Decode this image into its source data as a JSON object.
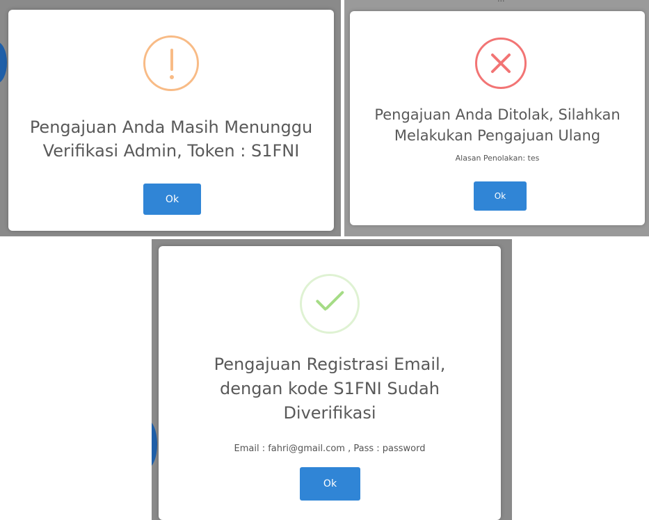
{
  "dialogs": {
    "warning": {
      "icon": "exclamation-icon",
      "icon_glyph": "!",
      "accent": "#f8bb86",
      "title_line1": "Pengajuan Anda Masih Menunggu",
      "title_line2": "Verifikasi Admin, Token : S1FNI",
      "ok_label": "Ok"
    },
    "error": {
      "icon": "x-mark-icon",
      "accent": "#f27474",
      "title_line1": "Pengajuan Anda Ditolak, Silahkan",
      "title_line2": "Melakukan Pengajuan Ulang",
      "reason": "Alasan Penolakan: tes",
      "ok_label": "Ok"
    },
    "success": {
      "icon": "checkmark-icon",
      "accent": "#a5dc86",
      "title_line1": "Pengajuan Registrasi Email,",
      "title_line2": "dengan kode S1FNI Sudah",
      "title_line3": "Diverifikasi",
      "detail": "Email : fahri@gmail.com , Pass : password",
      "ok_label": "Ok"
    }
  },
  "colors": {
    "button": "#3085d6",
    "backdrop": "#8a8a8a"
  }
}
